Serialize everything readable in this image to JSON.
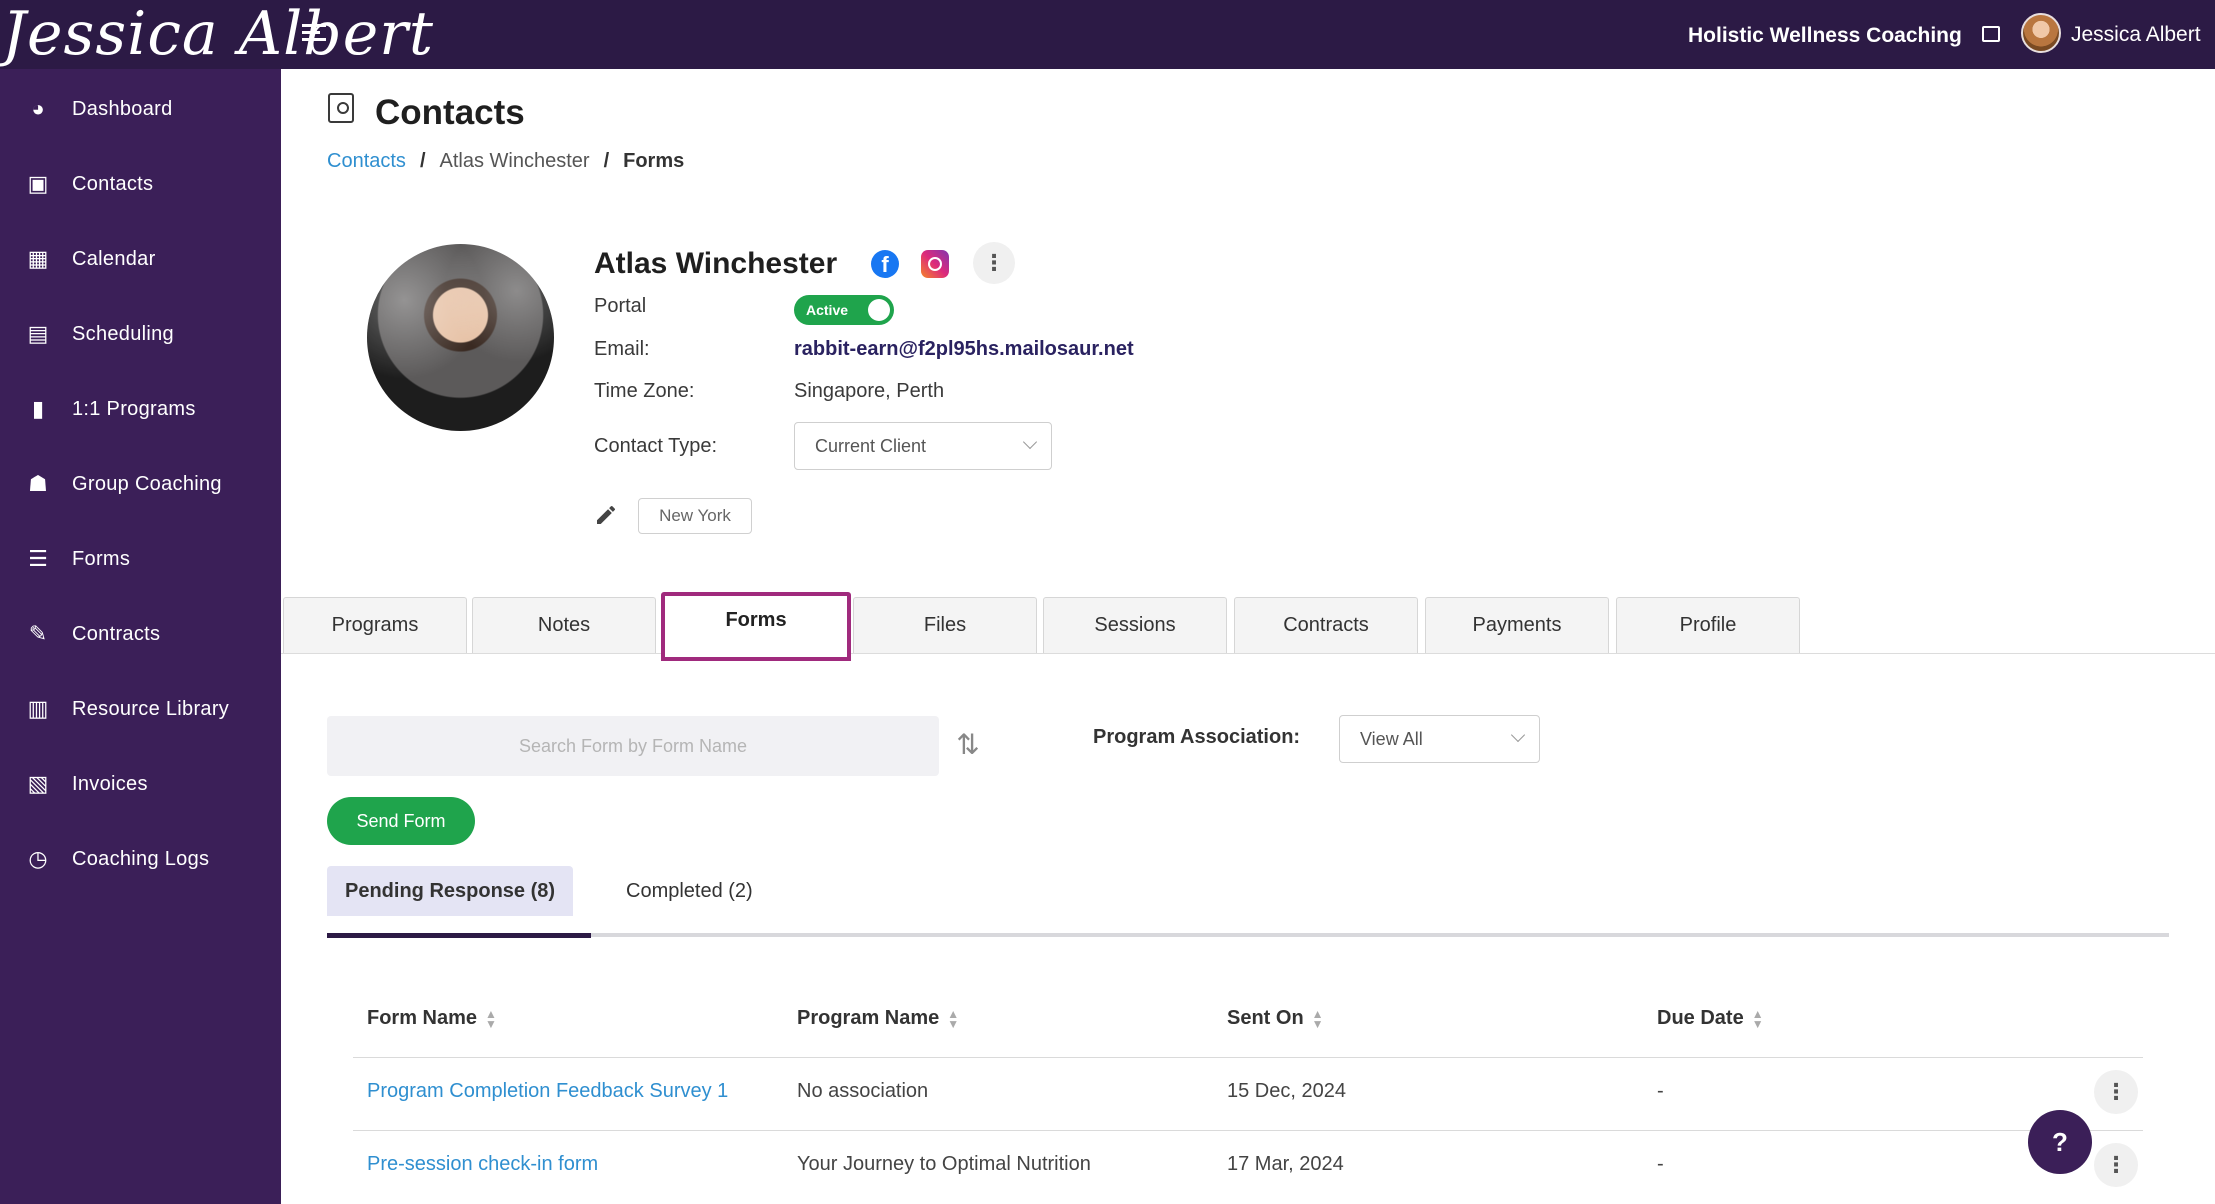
{
  "topbar": {
    "logo_text": "Jessica Albert",
    "business_name": "Holistic Wellness Coaching",
    "user_name": "Jessica Albert"
  },
  "sidebar": {
    "items": [
      {
        "label": "Dashboard",
        "icon": "dashboard-icon"
      },
      {
        "label": "Contacts",
        "icon": "contacts-icon"
      },
      {
        "label": "Calendar",
        "icon": "calendar-icon"
      },
      {
        "label": "Scheduling",
        "icon": "scheduling-icon"
      },
      {
        "label": "1:1 Programs",
        "icon": "book-icon"
      },
      {
        "label": "Group Coaching",
        "icon": "group-icon"
      },
      {
        "label": "Forms",
        "icon": "forms-icon"
      },
      {
        "label": "Contracts",
        "icon": "contract-icon"
      },
      {
        "label": "Resource Library",
        "icon": "library-icon"
      },
      {
        "label": "Invoices",
        "icon": "invoice-icon"
      },
      {
        "label": "Coaching Logs",
        "icon": "clock-icon"
      }
    ]
  },
  "page": {
    "title": "Contacts",
    "breadcrumb": [
      "Contacts",
      "Atlas Winchester",
      "Forms"
    ]
  },
  "contact": {
    "name": "Atlas Winchester",
    "portal_label": "Portal",
    "portal_status": "Active",
    "email_label": "Email:",
    "email": "rabbit-earn@f2pl95hs.mailosaur.net",
    "timezone_label": "Time Zone:",
    "timezone": "Singapore, Perth",
    "contact_type_label": "Contact Type:",
    "contact_type": "Current Client",
    "tag": "New York"
  },
  "tabs": [
    "Programs",
    "Notes",
    "Forms",
    "Files",
    "Sessions",
    "Contracts",
    "Payments",
    "Profile"
  ],
  "active_tab": "Forms",
  "forms": {
    "search_placeholder": "Search Form by Form Name",
    "program_association_label": "Program Association:",
    "program_association_value": "View All",
    "send_button": "Send Form",
    "subtabs": [
      "Pending Response (8)",
      "Completed (2)"
    ],
    "columns": [
      "Form Name",
      "Program Name",
      "Sent On",
      "Due Date"
    ],
    "rows": [
      {
        "form_name": "Program Completion Feedback Survey 1",
        "program_name": "No association",
        "sent_on": "15 Dec, 2024",
        "due_date": "-"
      },
      {
        "form_name": "Pre-session check-in form",
        "program_name": "Your Journey to Optimal Nutrition",
        "sent_on": "17 Mar, 2024",
        "due_date": "-"
      }
    ]
  },
  "help_label": "?",
  "colors": {
    "topbar": "#2c1a45",
    "sidebar": "#3b1f58",
    "accent_green": "#1fa44c",
    "link_blue": "#2f8fd0",
    "active_tab_border": "#a02a7d"
  }
}
